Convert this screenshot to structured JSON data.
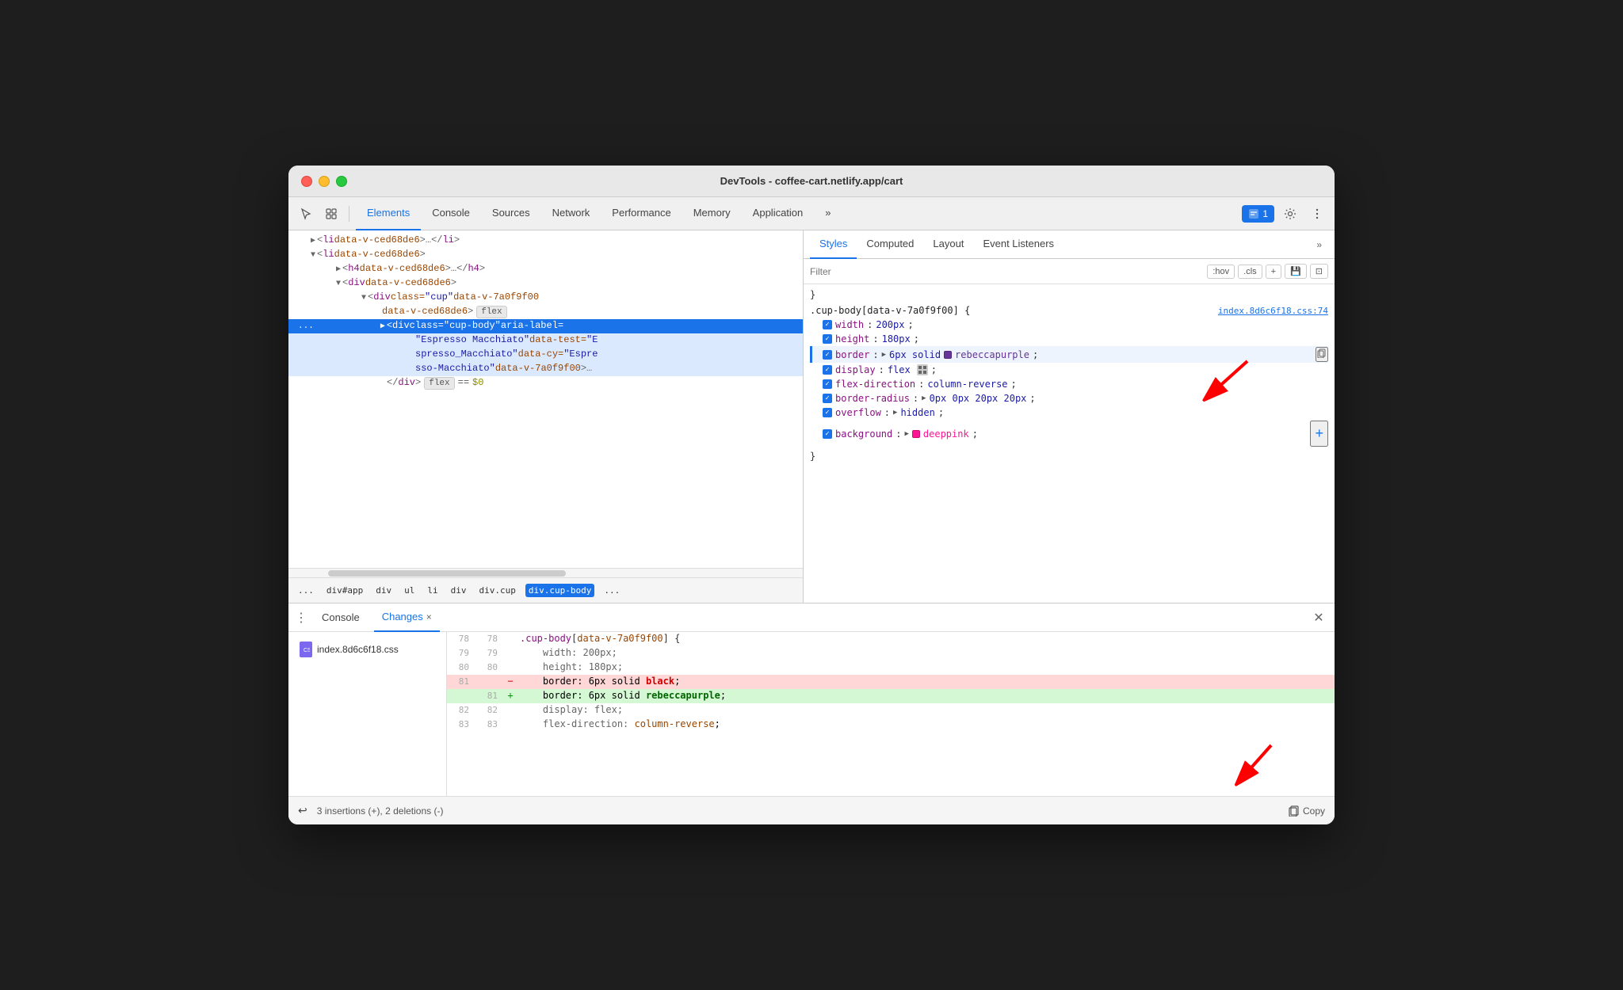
{
  "window": {
    "title": "DevTools - coffee-cart.netlify.app/cart",
    "traffic_lights": [
      "red",
      "yellow",
      "green"
    ]
  },
  "toolbar": {
    "tabs": [
      "Elements",
      "Console",
      "Sources",
      "Network",
      "Performance",
      "Memory",
      "Application"
    ],
    "active_tab": "Elements",
    "more_tabs_label": "»",
    "notification_count": "1",
    "icons": [
      "cursor-icon",
      "layers-icon"
    ]
  },
  "elements_panel": {
    "lines": [
      {
        "indent": 0,
        "content": "▶<li data-v-ced68de6>…</li>",
        "type": "collapsed"
      },
      {
        "indent": 0,
        "content": "▼<li data-v-ced68de6>",
        "type": "open"
      },
      {
        "indent": 1,
        "content": "▶<h4 data-v-ced68de6>…</h4>",
        "type": "collapsed"
      },
      {
        "indent": 1,
        "content": "▼<div data-v-ced68de6>",
        "type": "open"
      },
      {
        "indent": 2,
        "content": "▼<div class=\"cup\" data-v-7a0f9f00",
        "type": "open-partial"
      },
      {
        "indent": 3,
        "content": "data-v-ced68de6>  flex",
        "type": "badge"
      },
      {
        "indent": 3,
        "content": "▶<div class=\"cup-body\" aria-label=",
        "selected": true
      },
      {
        "indent": 4,
        "content": "\"Espresso Macchiato\" data-test=\"E"
      },
      {
        "indent": 4,
        "content": "spresso_Macchiato\" data-cy=\"Espre"
      },
      {
        "indent": 4,
        "content": "sso-Macchiato\" data-v-7a0f9f00>…"
      },
      {
        "indent": 3,
        "content": "</div>  flex  == $0"
      }
    ]
  },
  "breadcrumb": {
    "items": [
      "...",
      "div#app",
      "div",
      "ul",
      "li",
      "div",
      "div.cup",
      "div.cup-body",
      "..."
    ]
  },
  "styles_panel": {
    "tabs": [
      "Styles",
      "Computed",
      "Layout",
      "Event Listeners",
      "»"
    ],
    "active_tab": "Styles",
    "filter_placeholder": "Filter",
    "toolbar_buttons": [
      ":hov",
      ".cls",
      "+",
      "💾",
      "⊡"
    ],
    "rule": {
      "selector": ".cup-body[data-v-7a0f9f00] {",
      "source": "index.8d6c6f18.css:74",
      "properties": [
        {
          "checked": true,
          "name": "width",
          "value": "200px",
          "highlighted": false
        },
        {
          "checked": true,
          "name": "height",
          "value": "180px",
          "highlighted": false
        },
        {
          "checked": true,
          "name": "border",
          "value": "6px solid",
          "color": "rebeccapurple",
          "color_hex": "#663399",
          "highlighted": true
        },
        {
          "checked": true,
          "name": "display",
          "value": "flex",
          "icon": "grid",
          "highlighted": false
        },
        {
          "checked": true,
          "name": "flex-direction",
          "value": "column-reverse",
          "highlighted": false
        },
        {
          "checked": true,
          "name": "border-radius",
          "value": "0px 0px 20px 20px",
          "highlighted": false
        },
        {
          "checked": true,
          "name": "overflow",
          "value": "hidden",
          "highlighted": false
        },
        {
          "checked": true,
          "name": "background",
          "value": "deeppink",
          "color_hex": "#ff1493",
          "highlighted": false
        }
      ],
      "closing": "}"
    }
  },
  "bottom_drawer": {
    "tabs": [
      "Console",
      "Changes"
    ],
    "active_tab": "Changes",
    "file": "index.8d6c6f18.css",
    "diff": {
      "context_lines": [
        {
          "num_left": "78",
          "num_right": "78",
          "code": ".cup-body[data-v-7a0f9f00] {"
        },
        {
          "num_left": "79",
          "num_right": "79",
          "code": "    width: 200px;"
        },
        {
          "num_left": "80",
          "num_right": "80",
          "code": "    height: 180px;"
        }
      ],
      "removed_line": {
        "num_left": "81",
        "code": "    border: 6px solid black;",
        "keyword": "black"
      },
      "added_line": {
        "num_right": "81",
        "code": "    border: 6px solid rebeccapurple;",
        "keyword": "rebeccapurple"
      },
      "after_lines": [
        {
          "num_left": "82",
          "num_right": "82",
          "code": "    display: flex;"
        },
        {
          "num_left": "83",
          "num_right": "83",
          "code": "    flex-direction: column-reverse;"
        }
      ]
    },
    "summary": "3 insertions (+), 2 deletions (-)",
    "copy_label": "Copy",
    "undo_symbol": "↩"
  }
}
